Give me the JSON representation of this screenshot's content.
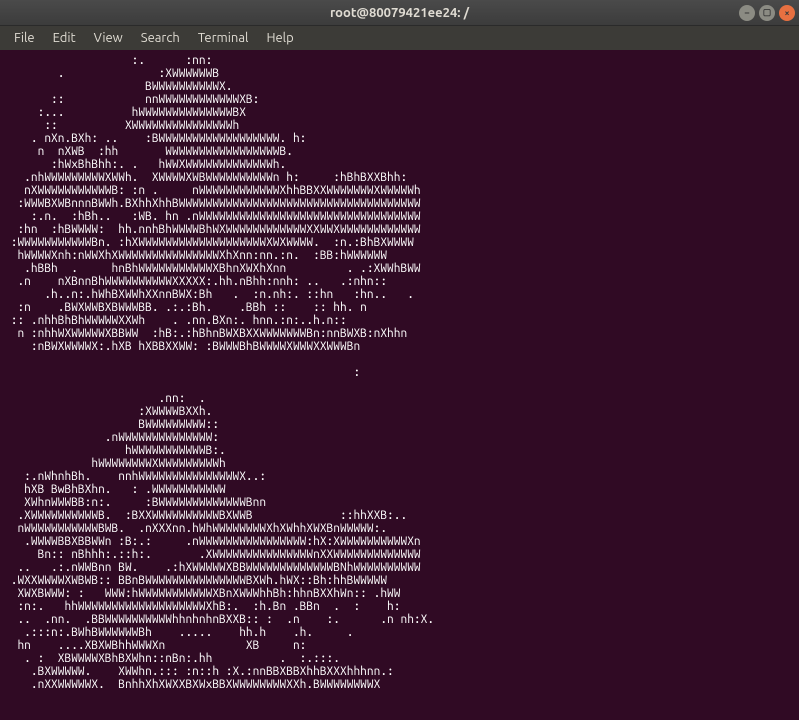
{
  "window": {
    "title": "root@80079421ee24: /"
  },
  "menubar": {
    "items": [
      "File",
      "Edit",
      "View",
      "Search",
      "Terminal",
      "Help"
    ]
  },
  "terminal": {
    "output": "                   :.      :nn:\n        .              :XWWWWWWB\n                     BWWWWWWWWWWX.\n       ::            nnWWWWWWWWWWWWXB:\n     :...          hWWWWWWWWWWWWWWBX\n      ::          XWWWWWWWWWWWWWWWh\n    . nXn.BXh: ..    :BWWWWWWWWWWWWWWWWWW. h:\n     n  nXWB  :hh       WWWWWWWWWWWWWWWWWB.\n       :hWxBhBhh:. .   hWWXWWWWWWWWWWWWWh.\n   .nhWWWWWWWWWXWWh.  XWWWWXWBWWWWWWWWWWn h:     :hBhBXXBhh:\n   nXWWWWWWWWWWWB: :n .     nWWWWWWWWWWWWXhhBBXXWWWWWWWXWWWWWh\n  :WWWBXWBnnnBWWh.BXhhXhhBWWWWWWWWWWWWWWWWWWWWWWWWWWWWWWWWWWWW\n    :.n.  :hBh..   :WB. hn .nWWWWWWWWWWWWWWWWWWWWWWWWWWWWWWWWW\n  :hn  :hBWWWW:  hh.nnhBhWWWWBhWXWWWWWWWWWWWWXXWWXWWWWWWWWWWWW\n :WWWWWWWWWWWBn. :hXWWWWWWWWWWWWWWWWWWWXWXWWWW.  :n.:BhBXWWWW\n  hWWWWXnh:nWWXhXWWWWWWWWWWWWWWWXhXnn:nn.:n.  :BB:hWWWWWW\n   .hBBh  .     hnBhWWWWWWWWWWWXBhnXWXhXnn         . .:XWWhBWW\n  .n    nXBnnBhWWWWWWWWWWXXXXX:.hh.nBhh:nnh: ..   .:nhn::\n      .h..n:.hWhBXWWhXXnnBWX:Bh   .  :n.nh:. ::hn   :hn..   .\n  :n    .BWXWWBXBWWWBB. .:.:Bh.    .BBh ::    :: hh. n\n :: .nhhBhBhWWWWWXXWh    . .nn.BXn:. hnn.:n:..h.n::\n  n :nhhWXWWWWWXBBWW  :hB:.:hBhnBWXBXXWWWWWWWBn:nnBWXB:nXhhn\n    :nBWXWWWWX:.hXB hXBBXXWW: :BWWWBhBWWWWXWWWXXWWWBn\n\n                                                    :\n\n                       .nn:  .\n                    :XWWWWBXXh.\n                    BWWWWWWWWW::\n               .nWWWWWWWWWWWWWW:\n                  hWWWWWWWWWWWB:.\n             hWWWWWWWWXWWWWWWWWWh\n   :.nWhnhBh.    nnhWWWWWWWWWWWWWWWX..:\n   hXB BwBhBXhn.   : .WWWWWWWWWWW\n   XWhnWWWBB:n:.     :BWWWWWWWWWWWWWBnn\n  .XWWWWWWWWWWB.  :BXXWWWWWWWWWWBXWWB             ::hhXXB:..\n  nWWWWWWWWWWWBWB.  .nXXXnn.hWhWWWWWWWWXhXWhhXWXBnWWWWW:.\n   .WWWWBBXBBWWn :B:.:     .nWWWWWWWWWWWWWWWW:hX:XWWWWWWWWWWXn\n     Bn:: nBhhh:.::h:.       .XWWWWWWWWWWWWWWWnXXWWWWWWWWWWWWW\n  ..   .:.nWWBnn BW.    .:hXWWWWWXBBWWWWWWWWWWWWWBNhWWWWWWWWWW\n .WXXWWWWXWBWB:: BBnBWWWWWWWWWWWWWWWBXWh.hWX::Bh:hhBWWWWW\n  XWXBWWW: :   WWW:hWWWWWWWWWWWXBnXWWWhhBh:hhnBXXhWn:: .hWW\n  :n:.   hhWWWWWWWWWWWWWWWWWWWXhB:.  :h.Bn .BBn  .  :    h:\n  ..  .nn.  .BBWWWWWWWWWWhhnhnhnBXXB:: :  .n    :.      .n nh:X.\n   .:::n:.BWhBWWWWWWBh    .....    hh.h    .h.     .\n  hn    ....XBXWBhhWWWXn            XB     n:\n   . :  XBWWWWXBhBXWhn::nBn:.hh          .  :.:::.\n    .BXWWWWW.    XWWhn.::: :n::h :X.:nnBBXBBXhhBXXXhhhnn.:\n    .nXXWWWWWX.  BnhhXhXWXXBXWxBBXWWWWWWWWXXh.BWWWWWWWWX\n\n\n                    .:n:. :.:\n   :     .  :  nh    hWWWWWWWXW:.h. .   .:"
  }
}
